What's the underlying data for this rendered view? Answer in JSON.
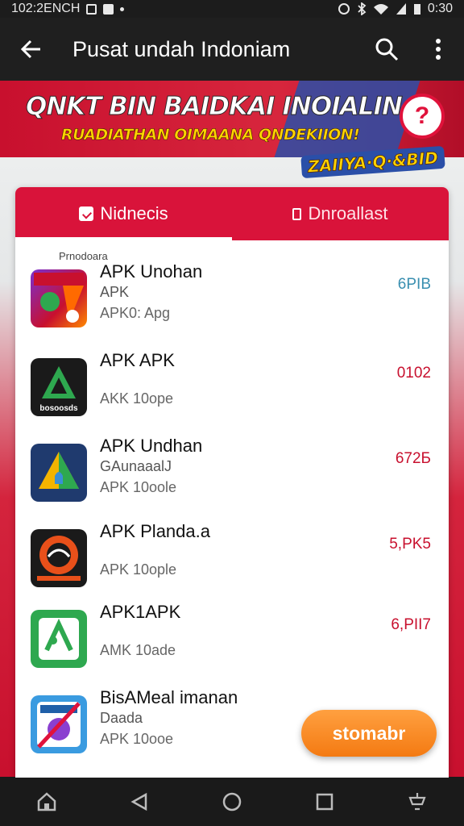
{
  "status_bar": {
    "time_left": "102:2ENCH",
    "time_right": "0:30"
  },
  "app_bar": {
    "title": "Pusat undah Indoniam",
    "back_icon": "arrow-left-icon",
    "search_icon": "search-icon",
    "menu_icon": "more-vert-icon"
  },
  "banner": {
    "headline": "QNKT BIN BAIDKAI INOIALIN",
    "subline": "RUADIATHAN OIMAANA QNDEKIION!",
    "help": "?",
    "brand": "ZAIIYA·Q·&BID"
  },
  "tabs": [
    {
      "label": "Nidnecis",
      "icon": "check-square-icon",
      "active": true
    },
    {
      "label": "Dnroallast",
      "icon": "rectangle-icon",
      "active": false
    }
  ],
  "section_label": "Prnodoara",
  "apps": [
    {
      "name": "APK Unohan",
      "sub": "APK",
      "meta": "APK0: Apg",
      "size": "6PIB",
      "size_color": "#3a8fb0"
    },
    {
      "name": "APK APK",
      "sub": "",
      "meta": "AKK 10ope",
      "size": "0102",
      "size_color": "#c8102e",
      "icon_label": "bosoosds"
    },
    {
      "name": "APK Undhan",
      "sub": "GAunaaalJ",
      "meta": "APK 10oole",
      "size": "672Б",
      "size_color": "#c8102e"
    },
    {
      "name": "APK Planda.a",
      "sub": "",
      "meta": "APK 10ople",
      "size": "5,PK5",
      "size_color": "#c8102e"
    },
    {
      "name": "APK1APK",
      "sub": "",
      "meta": "AMK 10ade",
      "size": "6,PII7",
      "size_color": "#c8102e"
    },
    {
      "name": "BisAMeal imanan",
      "sub": "Daada",
      "meta": "APK 10ooe",
      "size": "",
      "size_color": "#c8102e"
    }
  ],
  "fab": {
    "label": "stomabr"
  },
  "navbar": {
    "home": "home-icon",
    "back": "back-icon",
    "circle": "home-circle-icon",
    "recent": "recent-apps-icon",
    "extra": "keyboard-down-icon"
  }
}
